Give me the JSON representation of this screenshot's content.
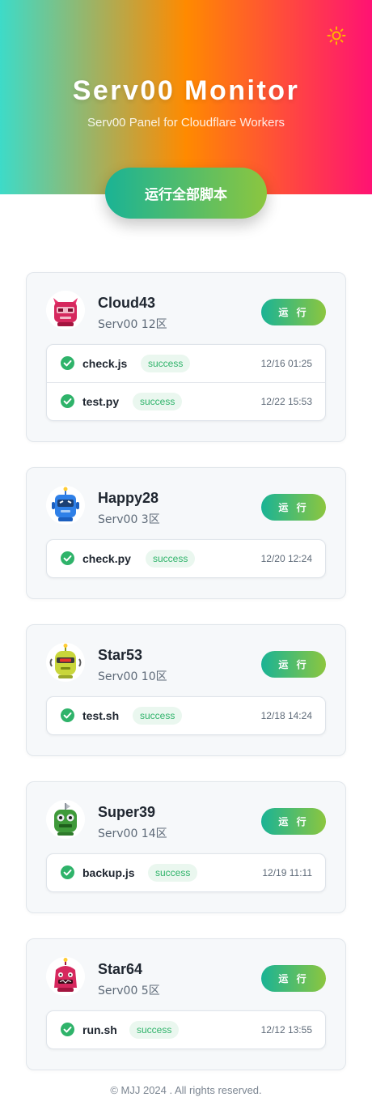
{
  "header": {
    "title": "Serv00 Monitor",
    "subtitle": "Serv00 Panel for Cloudflare Workers",
    "theme_toggle_icon": "sun-icon",
    "run_all_label": "运行全部脚本"
  },
  "colors": {
    "gradient_start": "#3ddbc8",
    "gradient_mid": "#ff8a00",
    "gradient_end": "#ff1273",
    "button_start": "#1ab395",
    "button_end": "#8cc63f",
    "success": "#2fb36a"
  },
  "accounts": [
    {
      "name": "Cloud43",
      "region": "Serv00 12区",
      "run_label": "运 行",
      "avatar_icon": "robot-avatar-icon",
      "scripts": [
        {
          "name": "check.js",
          "status": "success",
          "time": "12/16 01:25"
        },
        {
          "name": "test.py",
          "status": "success",
          "time": "12/22 15:53"
        }
      ]
    },
    {
      "name": "Happy28",
      "region": "Serv00 3区",
      "run_label": "运 行",
      "avatar_icon": "robot-avatar-icon",
      "scripts": [
        {
          "name": "check.py",
          "status": "success",
          "time": "12/20 12:24"
        }
      ]
    },
    {
      "name": "Star53",
      "region": "Serv00 10区",
      "run_label": "运 行",
      "avatar_icon": "robot-avatar-icon",
      "scripts": [
        {
          "name": "test.sh",
          "status": "success",
          "time": "12/18 14:24"
        }
      ]
    },
    {
      "name": "Super39",
      "region": "Serv00 14区",
      "run_label": "运 行",
      "avatar_icon": "robot-avatar-icon",
      "scripts": [
        {
          "name": "backup.js",
          "status": "success",
          "time": "12/19 11:11"
        }
      ]
    },
    {
      "name": "Star64",
      "region": "Serv00 5区",
      "run_label": "运 行",
      "avatar_icon": "robot-avatar-icon",
      "scripts": [
        {
          "name": "run.sh",
          "status": "success",
          "time": "12/12 13:55"
        }
      ]
    }
  ],
  "footer": {
    "text": "© MJJ 2024 . All rights reserved."
  }
}
